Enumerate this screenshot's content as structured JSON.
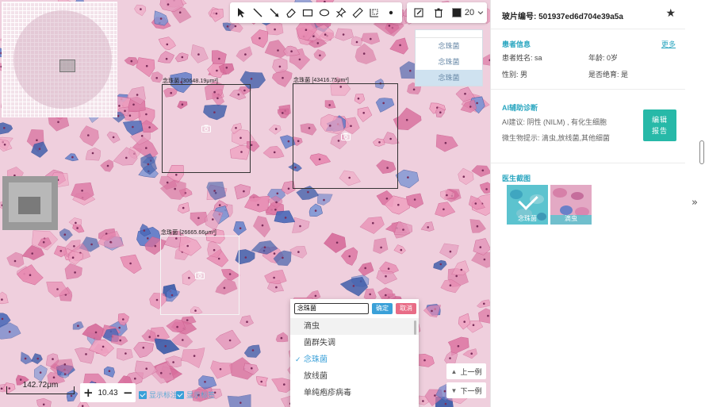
{
  "toolbar": {
    "tools": [
      "select-arrow-icon",
      "line-icon",
      "arrow-line-icon",
      "eraser-icon",
      "rectangle-icon",
      "ellipse-icon",
      "pin-icon",
      "ruler-icon",
      "measure-area-icon",
      "dot-icon"
    ],
    "stroke_width": "20",
    "color": "#222222"
  },
  "label_list": {
    "options": [
      "念珠菌",
      "念珠菌",
      "念珠菌"
    ],
    "selected_index": 2
  },
  "annotations": [
    {
      "tag": "念珠菌 [30648.19μm²]"
    },
    {
      "tag": "念珠菌 [43416.75μm²]"
    },
    {
      "tag": "念珠菌 [26665.66μm²]"
    }
  ],
  "scale": {
    "text": "142.72μm"
  },
  "zoom": {
    "value": "10.43",
    "plus": "+",
    "minus": "−"
  },
  "toggles": [
    {
      "label": "显示标注",
      "checked": true
    },
    {
      "label": "显示标签",
      "checked": true
    }
  ],
  "edit_popup": {
    "input_value": "念珠菌",
    "ok_label": "确定",
    "cancel_label": "取消",
    "items": [
      {
        "label": "滴虫",
        "checked": false,
        "hover": true
      },
      {
        "label": "菌群失调",
        "checked": false,
        "hover": false
      },
      {
        "label": "念珠菌",
        "checked": true,
        "hover": false
      },
      {
        "label": "放线菌",
        "checked": false,
        "hover": false
      },
      {
        "label": "单纯疱疹病毒",
        "checked": false,
        "hover": false
      }
    ]
  },
  "nav": {
    "prev": "上一例",
    "next": "下一例"
  },
  "panel": {
    "slide_label": "玻片编号:",
    "slide_id": "501937ed6d704e39a5a",
    "patient_title": "患者信息",
    "more": "更多",
    "name_label": "患者姓名:",
    "name_value": "sa",
    "age_label": "年龄:",
    "age_value": "0岁",
    "sex_label": "性别:",
    "sex_value": "男",
    "menopause_label": "是否绝育:",
    "menopause_value": "是",
    "ai_title": "AI辅助诊断",
    "ai_suggestion": "AI建议: 阴性 (NILM) , 有化生细胞",
    "ai_microbe": "微生物提示: 滴虫,放线菌,其他细菌",
    "edit_report_line1": "编辑",
    "edit_report_line2": "报告",
    "screenshot_title": "医生截图",
    "screenshots": [
      {
        "caption": "念珠菌",
        "selected": true
      },
      {
        "caption": "滴虫",
        "selected": false
      }
    ]
  }
}
